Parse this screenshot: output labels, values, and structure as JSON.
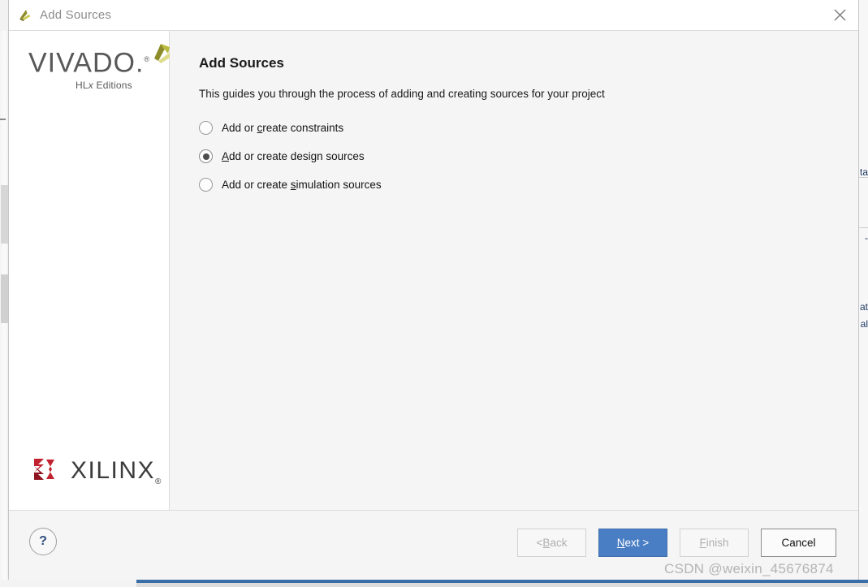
{
  "window": {
    "title": "Add Sources",
    "title_icon": "vivado-logo-icon",
    "close_icon": "close-icon"
  },
  "sidebar": {
    "product_name": "VIVADO",
    "product_edition_prefix": "HL",
    "product_edition_italic": "x",
    "product_edition_suffix": " Editions",
    "product_mark": "propeller-icon",
    "vendor_name": "XILINX",
    "vendor_mark": "xilinx-logo-icon",
    "registered_symbol": "®",
    "trademark_dot": "."
  },
  "main": {
    "heading": "Add Sources",
    "description": "This guides you through the process of adding and creating sources for your project",
    "options": [
      {
        "id": "constraints",
        "pre": "Add or ",
        "mnemonic": "c",
        "post": "reate constraints",
        "selected": false
      },
      {
        "id": "design-sources",
        "pre": "",
        "mnemonic": "A",
        "post": "dd or create design sources",
        "selected": true
      },
      {
        "id": "simulation-sources",
        "pre": "Add or create ",
        "mnemonic": "s",
        "post": "imulation sources",
        "selected": false
      }
    ]
  },
  "footer": {
    "help_label": "?",
    "buttons": [
      {
        "id": "back",
        "pre": "< ",
        "mnemonic": "B",
        "post": "ack",
        "state": "disabled"
      },
      {
        "id": "next",
        "pre": "",
        "mnemonic": "N",
        "post": "ext >",
        "state": "primary"
      },
      {
        "id": "finish",
        "pre": "",
        "mnemonic": "F",
        "post": "inish",
        "state": "disabled"
      },
      {
        "id": "cancel",
        "pre": "Cancel",
        "mnemonic": "",
        "post": "",
        "state": "normal"
      }
    ]
  },
  "background": {
    "fragments": [
      "ta",
      "-",
      "at",
      "al"
    ]
  },
  "watermark": "CSDN @weixin_45676874",
  "colors": {
    "primary_button": "#4a7ec4",
    "panel": "#f5f5f5",
    "sidebar": "#ffffff",
    "title_text": "#8c8c8c",
    "vivado_grey": "#58585a",
    "xilinx_red": "#c1222f",
    "help_blue": "#2c4c7c"
  }
}
